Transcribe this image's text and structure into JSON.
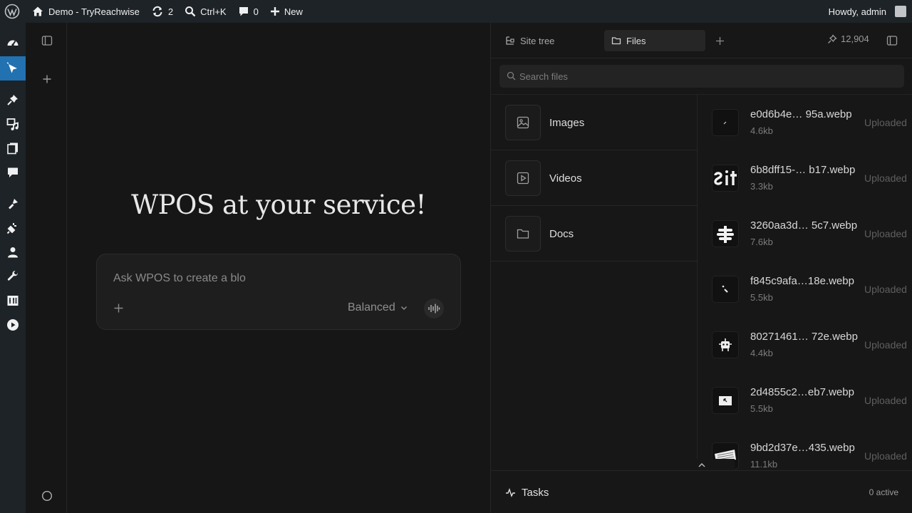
{
  "adminbar": {
    "site_name": "Demo - TryReachwise",
    "updates_count": "2",
    "search_shortcut": "Ctrl+K",
    "comments_count": "0",
    "new_label": "New",
    "howdy": "Howdy, admin"
  },
  "adminmenu": {
    "items": [
      "dashboard-icon",
      "wpos-icon",
      "pin-icon",
      "media-icon",
      "pages-icon",
      "comments-icon",
      "appearance-icon",
      "plugins-icon",
      "users-icon",
      "tools-icon",
      "settings-icon",
      "play-icon"
    ],
    "active_index": 1,
    "accent": "#2271b1"
  },
  "main": {
    "headline": "WPOS at your service!",
    "prompt_placeholder": "Ask WPOS to create a blo",
    "mode_label": "Balanced"
  },
  "panel": {
    "tabs": [
      {
        "label": "Site tree",
        "active": false
      },
      {
        "label": "Files",
        "active": true
      }
    ],
    "token_count": "12,904",
    "search_placeholder": "Search files",
    "folders": [
      {
        "label": "Images",
        "icon": "image-icon"
      },
      {
        "label": "Videos",
        "icon": "video-icon"
      },
      {
        "label": "Docs",
        "icon": "folder-icon"
      }
    ],
    "files": [
      {
        "name": "e0d6b4e…  95a.webp",
        "size": "4.6kb",
        "status": "Uploaded"
      },
      {
        "name": "6b8dff15-…  b17.webp",
        "size": "3.3kb",
        "status": "Uploaded"
      },
      {
        "name": "3260aa3d…  5c7.webp",
        "size": "7.6kb",
        "status": "Uploaded"
      },
      {
        "name": "f845c9afa…18e.webp",
        "size": "5.5kb",
        "status": "Uploaded"
      },
      {
        "name": "80271461…  72e.webp",
        "size": "4.4kb",
        "status": "Uploaded"
      },
      {
        "name": "2d4855c2…eb7.webp",
        "size": "5.5kb",
        "status": "Uploaded"
      },
      {
        "name": "9bd2d37e…435.webp",
        "size": "11.1kb",
        "status": "Uploaded"
      }
    ],
    "tasks_label": "Tasks",
    "tasks_count": "0 active"
  }
}
